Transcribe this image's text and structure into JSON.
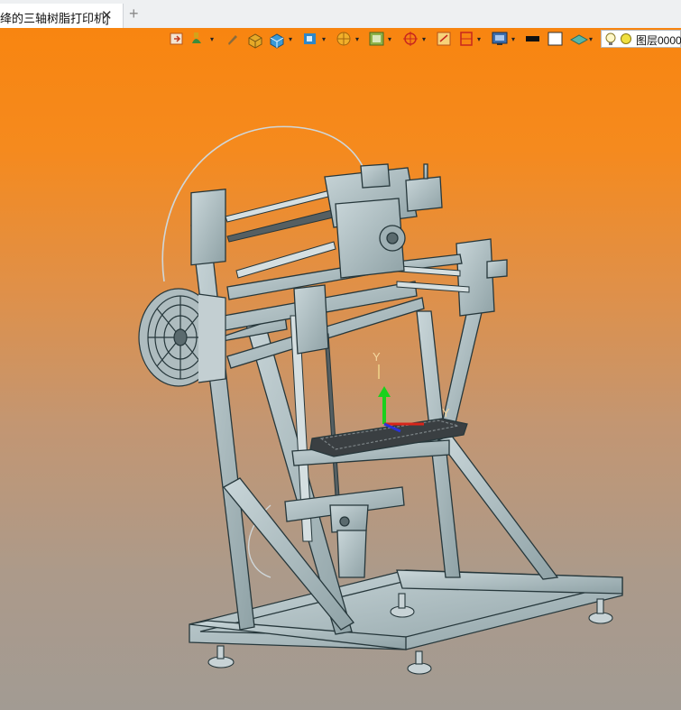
{
  "tab": {
    "title": "绛的三轴树脂打印机]",
    "close_glyph": "✕",
    "add_glyph": "+"
  },
  "toolbar": {
    "icons": [
      "export-icon",
      "pour-icon",
      "pen-icon",
      "cube-solid-icon",
      "cube-view-icon",
      "view-orient-icon",
      "section-icon",
      "render-mode-icon",
      "target-icon",
      "zoom-box-icon",
      "clip-icon",
      "display-icon",
      "color-swatch-black",
      "color-swatch-white",
      "layer-plane-icon"
    ],
    "layer": {
      "bulb_icon": "lightbulb-icon",
      "color_icon": "layer-color-icon",
      "label": "图层0000"
    }
  },
  "viewport": {
    "triad_label": "Y",
    "triad_label_z": "Y"
  },
  "colors": {
    "bg_top": "#f88510",
    "bg_bottom": "#a29b93",
    "metal": "#b7c5c8",
    "edge": "#26373b"
  }
}
